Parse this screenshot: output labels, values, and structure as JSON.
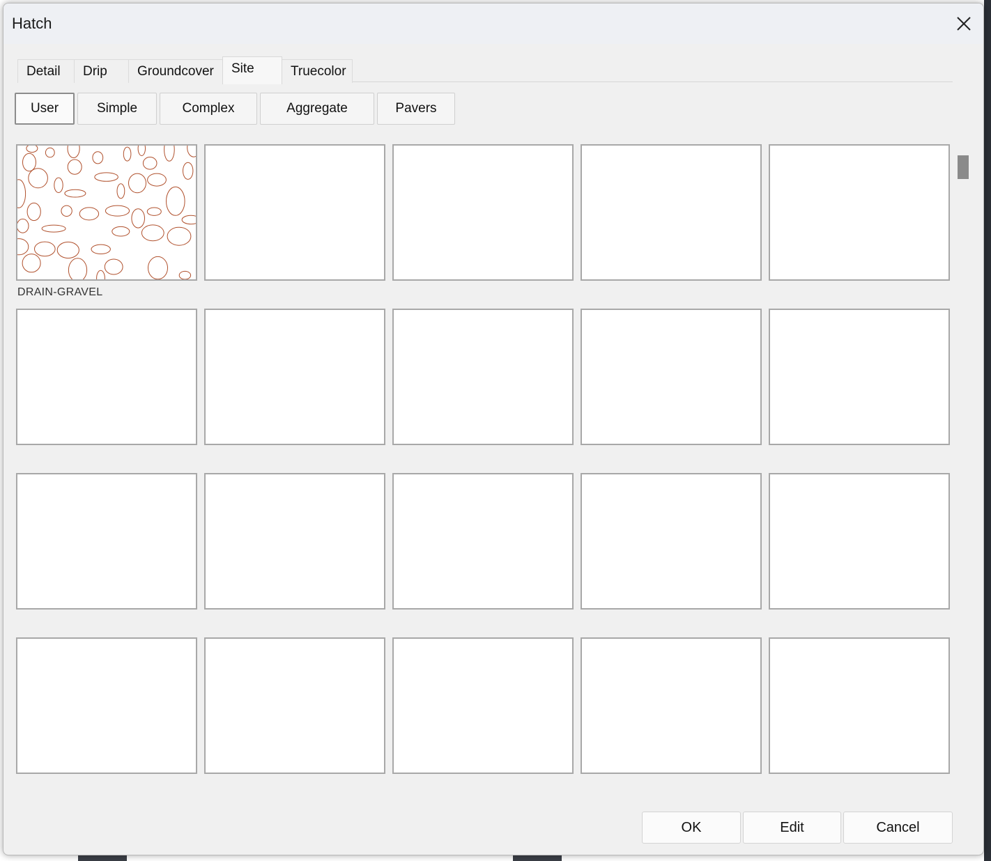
{
  "dialog": {
    "title": "Hatch"
  },
  "tabs": [
    {
      "label": "Detail",
      "active": false
    },
    {
      "label": "Drip",
      "active": false
    },
    {
      "label": "Groundcover",
      "active": false
    },
    {
      "label": "Site",
      "active": true
    },
    {
      "label": "Truecolor",
      "active": false
    }
  ],
  "sub_buttons": [
    {
      "label": "User",
      "active": true
    },
    {
      "label": "Simple",
      "active": false
    },
    {
      "label": "Complex",
      "active": false
    },
    {
      "label": "Aggregate",
      "active": false
    },
    {
      "label": "Pavers",
      "active": false
    }
  ],
  "grid": {
    "columns": 5,
    "rows": 4,
    "items": [
      {
        "label": "DRAIN-GRAVEL",
        "pattern": "gravel"
      }
    ]
  },
  "actions": {
    "ok_label": "OK",
    "edit_label": "Edit",
    "cancel_label": "Cancel"
  },
  "colors": {
    "gravel_stroke": "#b0502c",
    "dialog_bg": "#f0f0f0"
  }
}
